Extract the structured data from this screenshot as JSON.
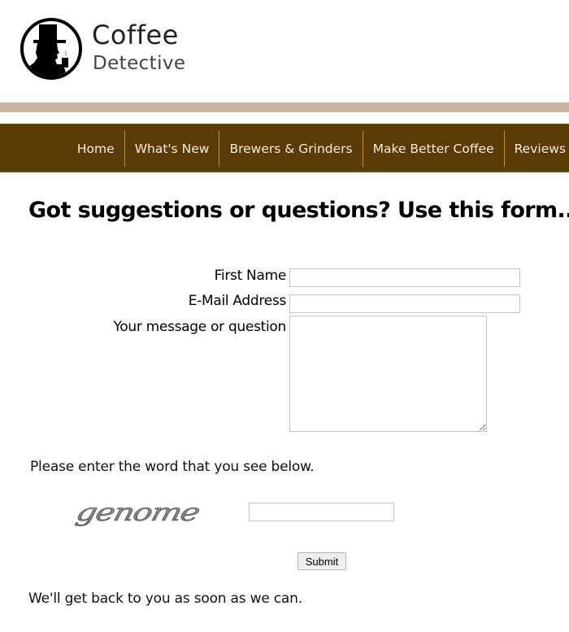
{
  "brand": {
    "name_line1": "Coffee",
    "name_line2": "Detective",
    "logo_icon": "detective-silhouette-icon"
  },
  "colors": {
    "nav_background": "#5a3a05",
    "nav_text": "#f4ece0",
    "nav_divider": "#c98a3a",
    "band": "#c8b4a0"
  },
  "nav": {
    "items": [
      {
        "label": "Home"
      },
      {
        "label": "What's New"
      },
      {
        "label": "Brewers & Grinders"
      },
      {
        "label": "Make Better Coffee"
      },
      {
        "label": "Reviews"
      }
    ]
  },
  "page": {
    "title": "Got suggestions or questions? Use this form..."
  },
  "form": {
    "first_name": {
      "label": "First Name",
      "value": ""
    },
    "email": {
      "label": "E-Mail Address",
      "value": ""
    },
    "message": {
      "label": "Your message or question",
      "value": ""
    },
    "captcha": {
      "prompt": "Please enter the word that you see below.",
      "image_word": "genome",
      "value": ""
    },
    "submit_label": "Submit"
  },
  "footer_note": "We'll get back to you as soon as we can."
}
